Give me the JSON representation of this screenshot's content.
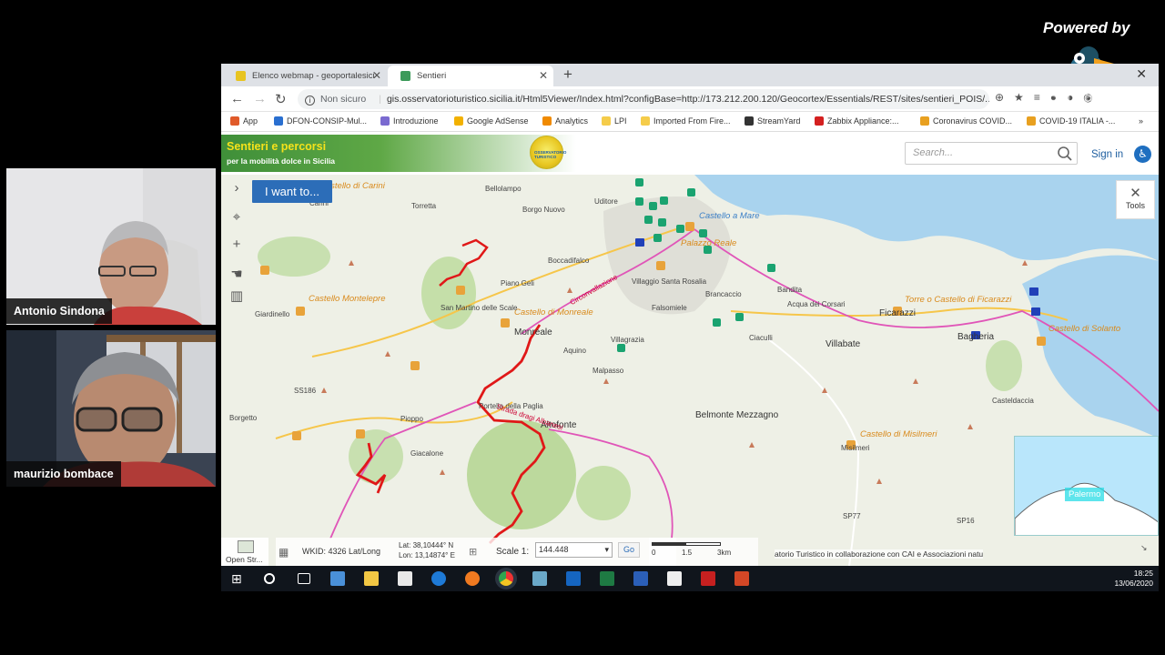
{
  "branding": {
    "powered_by": "Powered by",
    "streamyard_watermark": "StreamYard"
  },
  "participants": [
    {
      "name": "Antonio Sindona"
    },
    {
      "name": "maurizio bombace"
    }
  ],
  "browser": {
    "tabs": [
      {
        "label": "Elenco webmap - geoportalesici",
        "active": false
      },
      {
        "label": "Sentieri",
        "active": true
      }
    ],
    "url_security": "Non sicuro",
    "url": "gis.osservatorioturistico.sicilia.it/Html5Viewer/Index.html?configBase=http://173.212.200.120/Geocortex/Essentials/REST/sites/sentieri_POIS/...",
    "bookmarks": [
      "App",
      "DFON-CONSIP-Mul...",
      "Introduzione",
      "Google AdSense",
      "Analytics",
      "LPI",
      "Imported From Fire...",
      "StreamYard",
      "Zabbix Appliance:...",
      "Coronavirus COVID...",
      "COVID-19 ITALIA -..."
    ]
  },
  "app": {
    "title": "Sentieri e percorsi",
    "subtitle": "per la mobilità dolce in Sicilia",
    "logo_text": "OSSERVATORIO TURISTICO",
    "search_placeholder": "Search...",
    "signin": "Sign in",
    "i_want_to": "I want to...",
    "tools_label": "Tools"
  },
  "map": {
    "labels": {
      "castle": [
        "Castello di Carini",
        "Castello Montelepre",
        "Castello di Monreale",
        "Castello a Mare",
        "Palazzo Reale",
        "Torre o Castello di Ficarazzi",
        "Castello di Solanto",
        "Castello di Misilmeri"
      ],
      "places": [
        "Carini",
        "Bellolampo",
        "Torretta",
        "Borgo Nuovo",
        "Uditore",
        "Boccadifalco",
        "Piano Geli",
        "San Martino delle Scale",
        "Giardinello",
        "Monreale",
        "Villaggio Santa Rosalia",
        "Aquino",
        "Villagrazia",
        "Falsomiele",
        "Malpasso",
        "Brancaccio",
        "Bandita",
        "Acqua dei Corsari",
        "Ciaculli",
        "Ficarazzi",
        "Villabate",
        "Bagheria",
        "Casteldaccia",
        "Belmonte Mezzagno",
        "Misilmeri",
        "Borgetto",
        "Pioppo",
        "Giacalone",
        "Altofonte",
        "Portella della Paglia",
        "SS186",
        "SP77",
        "SP16"
      ],
      "roads": [
        "Strada dragi Albanesi",
        "Circonvallazione"
      ]
    },
    "overview_label": "Palermo",
    "attribution": "atorio Turistico in collaborazione con CAI e Associazioni natu",
    "bottom_bar": {
      "open_street": "Open Str...",
      "wkid": "WKID: 4326 Lat/Long",
      "lat": "Lat: 38,10444° N",
      "lon": "Lon: 13,14874° E",
      "scale_label": "Scale 1:",
      "scale_value": "144.448",
      "go": "Go",
      "scalebar_ticks": [
        "0",
        "1.5",
        "3km"
      ]
    }
  },
  "taskbar": {
    "time": "18:25",
    "date": "13/06/2020"
  },
  "colors": {
    "trail_red": "#e01818",
    "route_pink": "#e055b8",
    "poi_green": "#1aa370",
    "poi_orange": "#e8a33a",
    "accent_blue": "#2c6db8"
  }
}
